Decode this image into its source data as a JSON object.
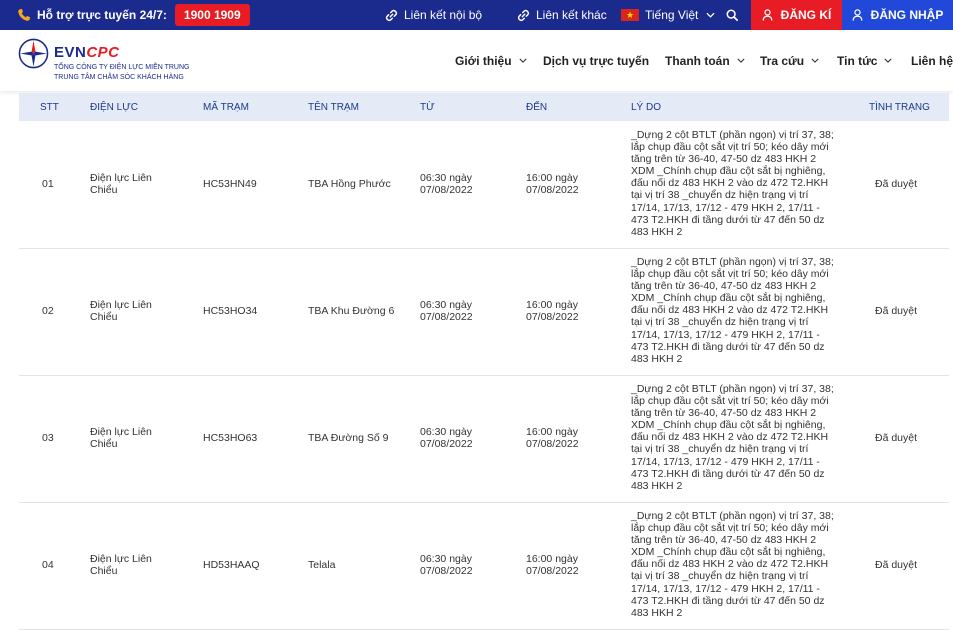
{
  "topbar": {
    "hotline_label": "Hỗ trợ trực tuyến 24/7:",
    "hotline_number": "1900 1909",
    "internal_links": "Liên kết nội bộ",
    "other_links": "Liên kết khác",
    "language": "Tiếng Việt",
    "register": "ĐĂNG KÍ",
    "login": "ĐĂNG NHẬP"
  },
  "brand": {
    "evn": "EVN",
    "cpc": "CPC",
    "subtitle1": "TỔNG CÔNG TY ĐIỆN LỰC MIỀN TRUNG",
    "subtitle2": "TRUNG TÂM CHĂM SÓC KHÁCH HÀNG"
  },
  "nav": {
    "items": [
      {
        "label": "Giới thiệu"
      },
      {
        "label": "Dịch vụ trực tuyến"
      },
      {
        "label": "Thanh toán"
      },
      {
        "label": "Tra cứu"
      },
      {
        "label": "Tin tức"
      },
      {
        "label": "Liên hệ"
      }
    ]
  },
  "table": {
    "headers": {
      "stt": "STT",
      "dien_luc": "ĐIỆN LỰC",
      "ma_tram": "MÃ TRẠM",
      "ten_tram": "TÊN TRẠM",
      "tu": "TỪ",
      "den": "ĐẾN",
      "ly_do": "LÝ DO",
      "tinh_trang": "TÌNH TRẠNG"
    },
    "rows": [
      {
        "stt": "01",
        "dien_luc": "Điện lực Liên Chiểu",
        "ma_tram": "HC53HN49",
        "ten_tram": "TBA Hồng Phước",
        "tu": "06:30 ngày 07/08/2022",
        "den": "16:00 ngày 07/08/2022",
        "ly_do": "_Dựng 2 cột BTLT (phần ngọn) vị trí 37, 38; lắp chụp đầu cột sắt vịt trí 50; kéo dây mới tăng trên từ 36-40, 47-50 dz 483 HKH 2 XDM _Chính chụp đầu cột sắt bị nghiêng, đấu nối dz 483 HKH 2 vào dz 472 T2.HKH tại vị trí 38 _chuyển dz hiện trạng vị trí 17/14, 17/13, 17/12 - 479 HKH 2, 17/11 - 473 T2.HKH đi tầng dưới từ 47 đến 50 dz 483 HKH 2",
        "tinh_trang": "Đã duyệt"
      },
      {
        "stt": "02",
        "dien_luc": "Điện lực Liên Chiểu",
        "ma_tram": "HC53HO34",
        "ten_tram": "TBA Khu Đường 6",
        "tu": "06:30 ngày 07/08/2022",
        "den": "16:00 ngày 07/08/2022",
        "ly_do": "_Dựng 2 cột BTLT (phần ngọn) vị trí 37, 38; lắp chụp đầu cột sắt vịt trí 50; kéo dây mới tăng trên từ 36-40, 47-50 dz 483 HKH 2 XDM _Chính chụp đầu cột sắt bị nghiêng, đấu nối dz 483 HKH 2 vào dz 472 T2.HKH tại vị trí 38 _chuyển dz hiện trạng vị trí 17/14, 17/13, 17/12 - 479 HKH 2, 17/11 - 473 T2.HKH đi tầng dưới từ 47 đến 50 dz 483 HKH 2",
        "tinh_trang": "Đã duyệt"
      },
      {
        "stt": "03",
        "dien_luc": "Điện lực Liên Chiểu",
        "ma_tram": "HC53HO63",
        "ten_tram": "TBA Đường Số 9",
        "tu": "06:30 ngày 07/08/2022",
        "den": "16:00 ngày 07/08/2022",
        "ly_do": "_Dựng 2 cột BTLT (phần ngọn) vị trí 37, 38; lắp chụp đầu cột sắt vịt trí 50; kéo dây mới tăng trên từ 36-40, 47-50 dz 483 HKH 2 XDM _Chính chụp đầu cột sắt bị nghiêng, đấu nối dz 483 HKH 2 vào dz 472 T2.HKH tại vị trí 38 _chuyển dz hiện trạng vị trí 17/14, 17/13, 17/12 - 479 HKH 2, 17/11 - 473 T2.HKH đi tầng dưới từ 47 đến 50 dz 483 HKH 2",
        "tinh_trang": "Đã duyệt"
      },
      {
        "stt": "04",
        "dien_luc": "Điện lực Liên Chiểu",
        "ma_tram": "HD53HAAQ",
        "ten_tram": "Telala",
        "tu": "06:30 ngày 07/08/2022",
        "den": "16:00 ngày 07/08/2022",
        "ly_do": "_Dựng 2 cột BTLT (phần ngọn) vị trí 37, 38; lắp chụp đầu cột sắt vịt trí 50; kéo dây mới tăng trên từ 36-40, 47-50 dz 483 HKH 2 XDM _Chính chụp đầu cột sắt bị nghiêng, đấu nối dz 483 HKH 2 vào dz 472 T2.HKH tại vị trí 38 _chuyển dz hiện trạng vị trí 17/14, 17/13, 17/12 - 479 HKH 2, 17/11 - 473 T2.HKH đi tầng dưới từ 47 đến 50 dz 483 HKH 2",
        "tinh_trang": "Đã duyệt"
      }
    ]
  },
  "colors": {
    "topbar_bg": "#1a2a8d",
    "hotline_bg": "#e81c24",
    "register_bg": "#e81c24",
    "login_bg": "#2148d8",
    "table_header_bg": "#e4ebf7"
  },
  "icons": {
    "hotline": "phone-icon",
    "internal_links": "link-icon",
    "other_links": "link-icon",
    "language": "vietnam-flag-icon",
    "search": "search-icon",
    "register": "user-icon",
    "login": "user-icon"
  }
}
